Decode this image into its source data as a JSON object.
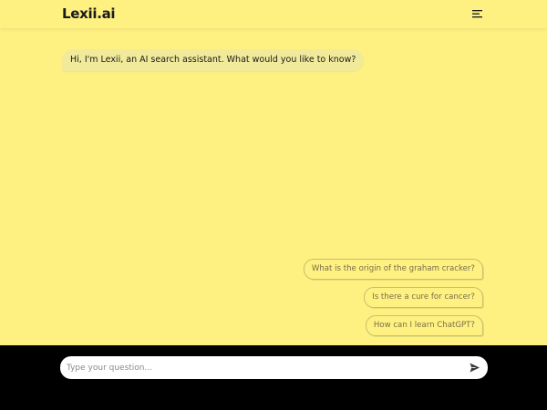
{
  "header": {
    "logo": "Lexii.ai",
    "menu_icon": "hamburger-menu-icon"
  },
  "chat": {
    "assistant_message": "Hi, I'm Lexii, an AI search assistant. What would you like to know?"
  },
  "suggestions": [
    {
      "label": "What is the origin of the graham cracker?"
    },
    {
      "label": "Is there a cure for cancer?"
    },
    {
      "label": "How can I learn ChatGPT?"
    }
  ],
  "composer": {
    "placeholder": "Type your question...",
    "value": "",
    "send_icon": "send-icon"
  },
  "colors": {
    "background": "#fef081",
    "footer": "#000000",
    "bubble": "#f1ea9a",
    "suggestion_border": "#c8bf6a",
    "suggestion_text": "#777049"
  }
}
